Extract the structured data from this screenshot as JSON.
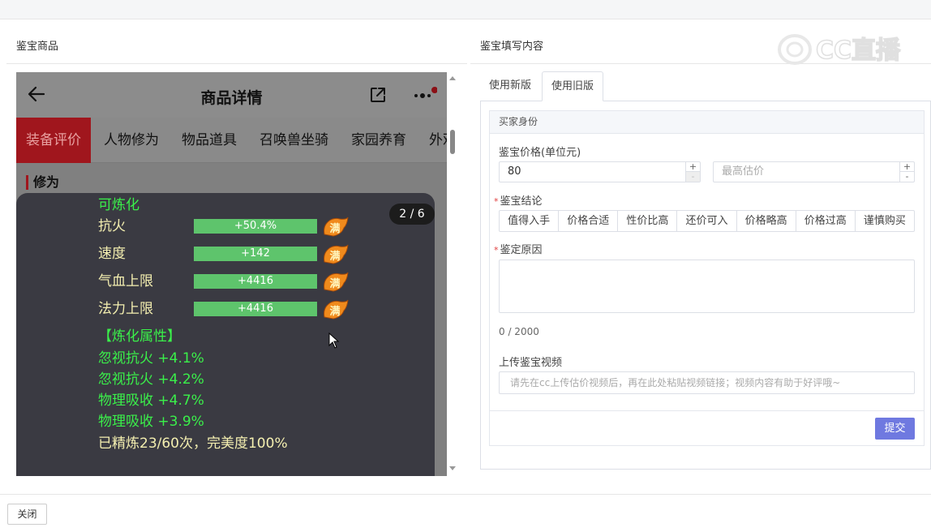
{
  "left_panel": {
    "title": "鉴宝商品",
    "phone": {
      "header_title": "商品详情",
      "tabs": [
        "装备评价",
        "人物修为",
        "物品道具",
        "召唤兽坐骑",
        "家园养育",
        "外观"
      ],
      "section_label": "修为",
      "popup": {
        "counter": "2 / 6",
        "refine_label": "可炼化",
        "stats": [
          {
            "name": "抗火",
            "value": "+50.4%",
            "fill_percent": 100,
            "badge": "满"
          },
          {
            "name": "速度",
            "value": "+142",
            "fill_percent": 100,
            "badge": "满"
          },
          {
            "name": "气血上限",
            "value": "+4416",
            "fill_percent": 100,
            "badge": "满"
          },
          {
            "name": "法力上限",
            "value": "+4416",
            "fill_percent": 100,
            "badge": "满"
          }
        ],
        "refine_attr_title": "【炼化属性】",
        "refine_attrs": [
          "忽视抗火 +4.1%",
          "忽视抗火 +4.2%",
          "物理吸收 +4.7%",
          "物理吸收 +3.9%"
        ],
        "refine_summary": "已精炼23/60次，完美度100%"
      }
    }
  },
  "right_panel": {
    "title": "鉴宝填写内容",
    "watermark": "CC直播",
    "tabs": [
      {
        "label": "使用新版",
        "active": false
      },
      {
        "label": "使用旧版",
        "active": true
      }
    ],
    "form": {
      "buyer_identity": "买家身份",
      "price_label": "鉴宝价格(单位元)",
      "price_value": "80",
      "max_estimate_placeholder": "最高估价",
      "conclusion_label": "鉴宝结论",
      "conclusion_options": [
        "值得入手",
        "价格合适",
        "性价比高",
        "还价可入",
        "价格略高",
        "价格过高",
        "谨慎购买"
      ],
      "reason_label": "鉴定原因",
      "reason_counter": "0 / 2000",
      "video_label": "上传鉴宝视频",
      "video_placeholder": "请先在cc上传估价视频后，再在此处粘贴视频链接；视频内容有助于好评哦~",
      "submit_label": "提交"
    }
  },
  "footer": {
    "close_label": "关闭"
  },
  "colors": {
    "accent": "#6f79e0",
    "tab_active": "#a0161d",
    "bar_fill": "#5ec46c",
    "refine_text": "#3af04a"
  }
}
